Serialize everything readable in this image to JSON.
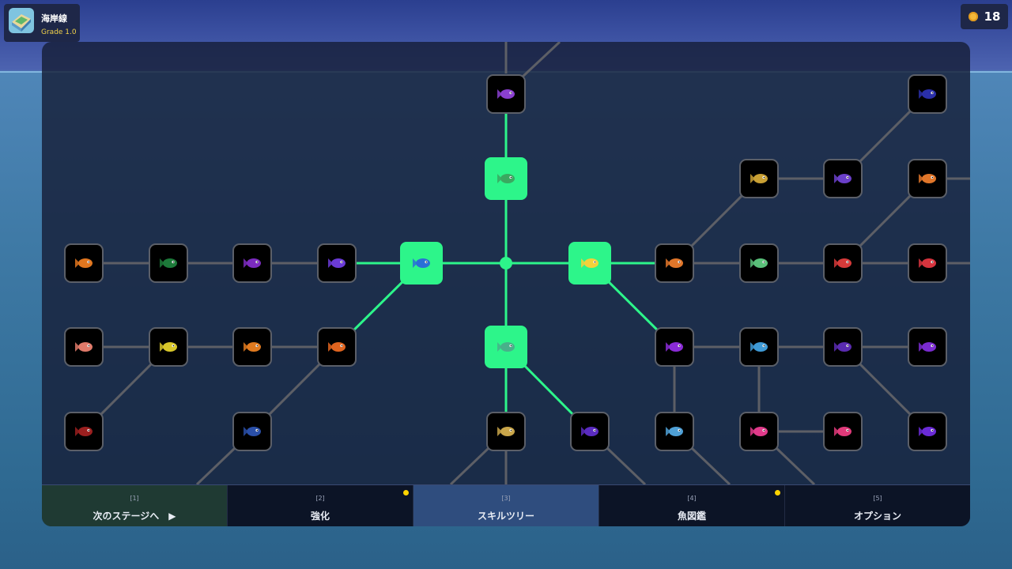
{
  "stage": {
    "name": "海岸線",
    "grade": "Grade 1.0"
  },
  "coins": {
    "count": "18"
  },
  "colors": {
    "accent": "#2df58a",
    "inactive_border": "#5b5f68",
    "notify": "#ffd400"
  },
  "skill_tree": {
    "nodes": [
      {
        "id": "n-top",
        "fish": "#8a3fd0",
        "unlocked": false
      },
      {
        "id": "n-c1",
        "fish": "#3aa860",
        "unlocked": true
      },
      {
        "id": "n-left",
        "fish": "#2a6fd6",
        "unlocked": true
      },
      {
        "id": "n-right",
        "fish": "#f3d13a",
        "unlocked": true
      },
      {
        "id": "n-down",
        "fish": "#48b08a",
        "unlocked": true
      },
      {
        "id": "n-a",
        "fish": "#e0761f",
        "unlocked": false
      },
      {
        "id": "n-b",
        "fish": "#1d7a3a",
        "unlocked": false
      },
      {
        "id": "n-c",
        "fish": "#7b2bbf",
        "unlocked": false
      },
      {
        "id": "n-d",
        "fish": "#6a3bd6",
        "unlocked": false
      },
      {
        "id": "n-e",
        "fish": "#e07a6a",
        "unlocked": false
      },
      {
        "id": "n-f",
        "fish": "#d8c72a",
        "unlocked": false
      },
      {
        "id": "n-g",
        "fish": "#e07a1f",
        "unlocked": false
      },
      {
        "id": "n-h",
        "fish": "#e0641f",
        "unlocked": false
      },
      {
        "id": "n-i",
        "fish": "#9a1f1f",
        "unlocked": false
      },
      {
        "id": "n-j",
        "fish": "#2a4fa8",
        "unlocked": false
      },
      {
        "id": "n-k",
        "fish": "#c9a64a",
        "unlocked": false
      },
      {
        "id": "n-l",
        "fish": "#5a2bc0",
        "unlocked": false
      },
      {
        "id": "n-m",
        "fish": "#e0762a",
        "unlocked": false
      },
      {
        "id": "n-n",
        "fish": "#5ac07a",
        "unlocked": false
      },
      {
        "id": "n-o",
        "fish": "#d63a3a",
        "unlocked": false
      },
      {
        "id": "n-p",
        "fish": "#d6343e",
        "unlocked": false
      },
      {
        "id": "n-q",
        "fish": "#c9a034",
        "unlocked": false
      },
      {
        "id": "n-r",
        "fish": "#6a3fc9",
        "unlocked": false
      },
      {
        "id": "n-s",
        "fish": "#e0762a",
        "unlocked": false
      },
      {
        "id": "n-t",
        "fish": "#2a2fa8",
        "unlocked": false
      },
      {
        "id": "n-u",
        "fish": "#8a2bd6",
        "unlocked": false
      },
      {
        "id": "n-v",
        "fish": "#3f9ad6",
        "unlocked": false
      },
      {
        "id": "n-w",
        "fish": "#5a2bb0",
        "unlocked": false
      },
      {
        "id": "n-x",
        "fish": "#7a2bd0",
        "unlocked": false
      },
      {
        "id": "n-y",
        "fish": "#4fa0d6",
        "unlocked": false
      },
      {
        "id": "n-z",
        "fish": "#e03a8a",
        "unlocked": false
      },
      {
        "id": "n-aa",
        "fish": "#e03a7a",
        "unlocked": false
      },
      {
        "id": "n-ab",
        "fish": "#6a2bd6",
        "unlocked": false
      }
    ]
  },
  "tabs": [
    {
      "key": "[1]",
      "label": "次のステージへ　▶"
    },
    {
      "key": "[2]",
      "label": "強化"
    },
    {
      "key": "[3]",
      "label": "スキルツリー"
    },
    {
      "key": "[4]",
      "label": "魚図鑑"
    },
    {
      "key": "[5]",
      "label": "オプション"
    }
  ]
}
